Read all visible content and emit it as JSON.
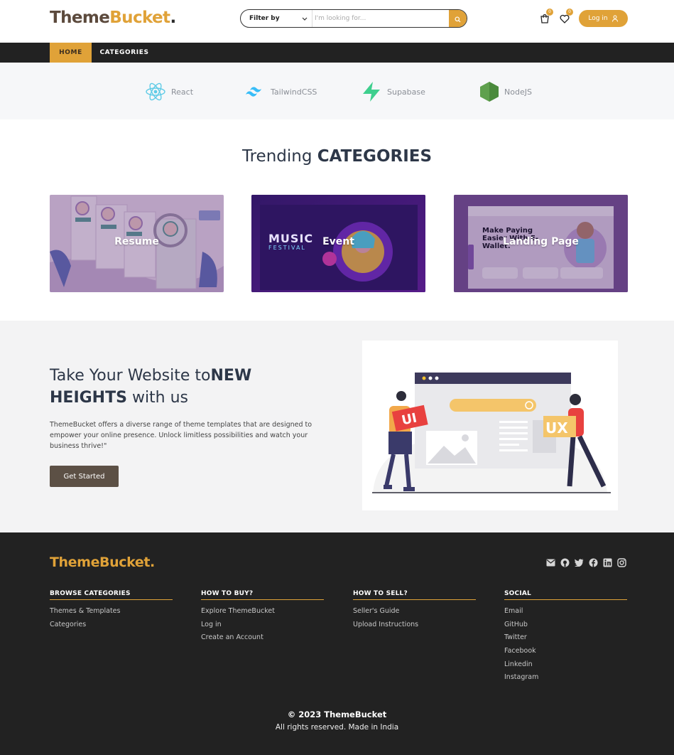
{
  "header": {
    "logo": {
      "part1": "Theme",
      "part2": "Bucket",
      "dot": "."
    },
    "search": {
      "filter_label": "Filter by",
      "placeholder": "I'm looking for..."
    },
    "cart_count": "0",
    "wishlist_count": "0",
    "login_label": "Log in"
  },
  "nav": {
    "home": "HOME",
    "categories": "CATEGORIES"
  },
  "tech": [
    {
      "name": "React"
    },
    {
      "name": "TailwindCSS"
    },
    {
      "name": "Supabase"
    },
    {
      "name": "NodeJS"
    }
  ],
  "trending": {
    "title_light": "Trending ",
    "title_bold": "CATEGORIES",
    "cards": [
      {
        "label": "Resume"
      },
      {
        "label": "Event",
        "thumb_text": "MUSIC",
        "thumb_text2": "FESTIVAL"
      },
      {
        "label": "Landing Page",
        "thumb_text": "Make Paying Easier With E-Wallet."
      }
    ]
  },
  "hero": {
    "title_light1": "Take Your Website to",
    "title_bold1": "NEW",
    "title_bold2": "HEIGHTS",
    "title_light2": " with us",
    "description": "ThemeBucket offers a diverse range of theme templates that are designed to empower your online presence. Unlock limitless possibilities and watch your business thrive!\"",
    "cta": "Get Started",
    "illus_ui": "UI",
    "illus_ux": "UX"
  },
  "footer": {
    "logo": "ThemeBucket.",
    "columns": [
      {
        "title": "BROWSE CATEGORIES",
        "links": [
          "Themes & Templates",
          "Categories"
        ]
      },
      {
        "title": "HOW TO BUY?",
        "links": [
          "Explore ThemeBucket",
          "Log in",
          "Create an Account"
        ]
      },
      {
        "title": "HOW TO SELL?",
        "links": [
          "Seller's Guide",
          "Upload Instructions"
        ]
      },
      {
        "title": "SOCIAL",
        "links": [
          "Email",
          "GitHub",
          "Twitter",
          "Facebook",
          "Linkedin",
          "Instagram"
        ]
      }
    ],
    "copyright": "© 2023 ThemeBucket",
    "rights": "All rights reserved. Made in India"
  },
  "colors": {
    "accent": "#e0a238",
    "dark": "#222222",
    "brown": "#5c4a3d"
  }
}
